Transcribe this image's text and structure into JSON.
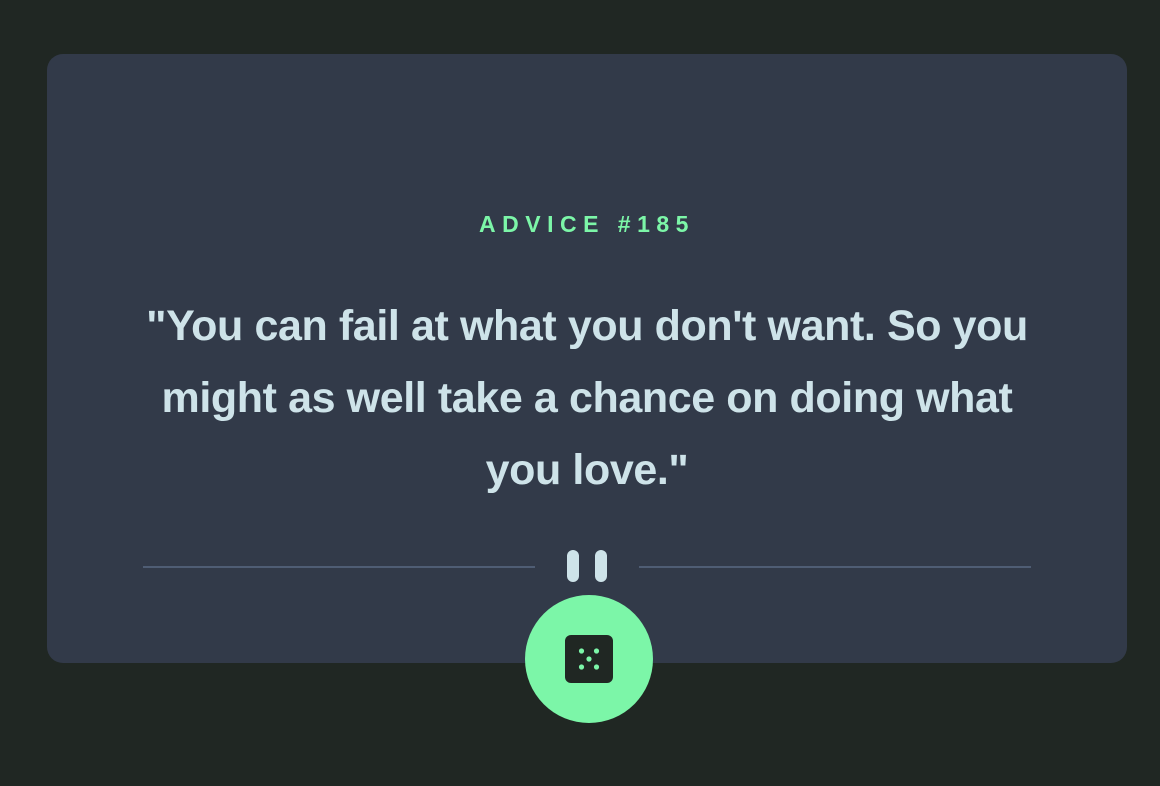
{
  "advice": {
    "label": "ADVICE #185",
    "quote": "\"You can fail at what you don't want. So you might as well take a chance on doing what you love.\""
  },
  "divider": {
    "icon": "pause-icon"
  },
  "generate_button": {
    "icon": "dice-icon"
  },
  "colors": {
    "background": "#202723",
    "card": "#323a49",
    "accent": "#7cf6a8",
    "text": "#cee3e9",
    "divider": "#4f5d74"
  }
}
